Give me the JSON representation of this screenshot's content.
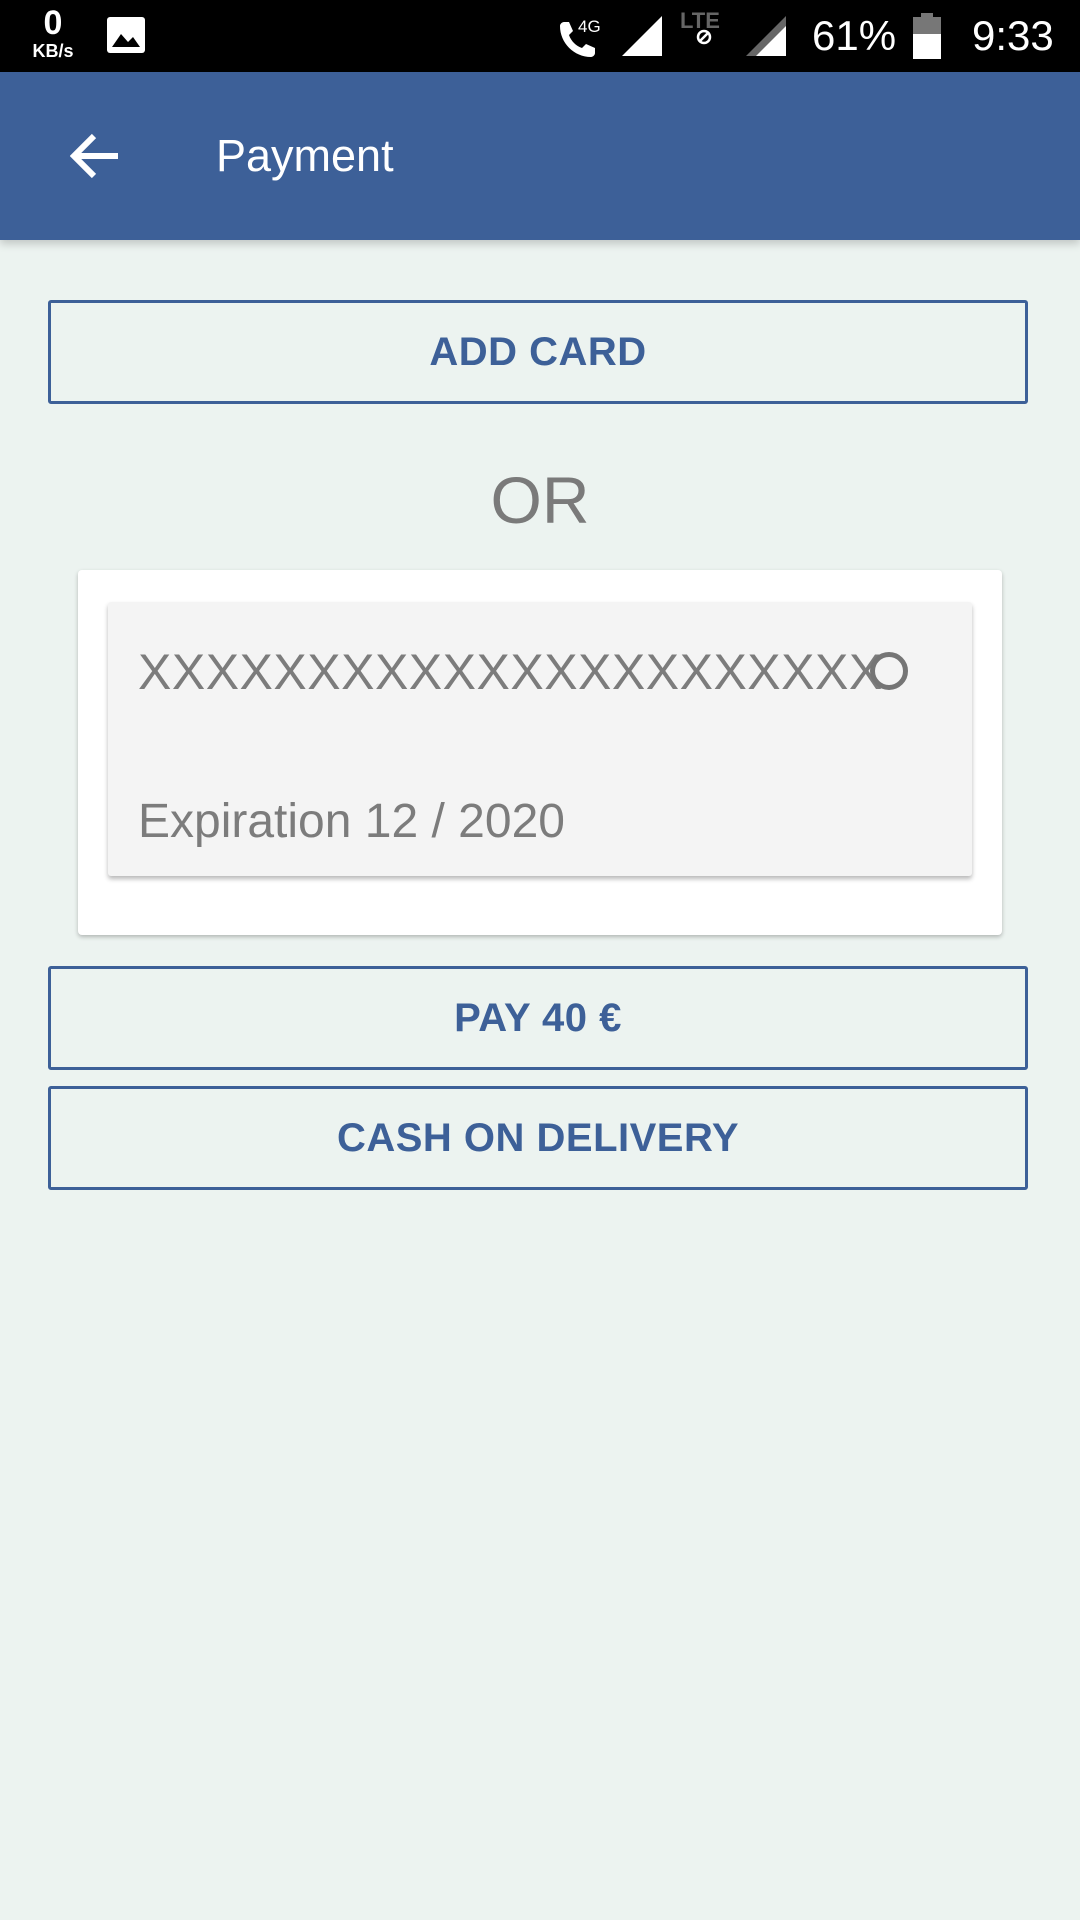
{
  "status_bar": {
    "net_speed_value": "0",
    "net_speed_unit": "KB/s",
    "call_network_label": "4G",
    "lte_label": "LTE",
    "battery_percent": "61%",
    "time": "9:33"
  },
  "app_bar": {
    "title": "Payment"
  },
  "actions": {
    "add_card_label": "ADD CARD",
    "or_label": "OR",
    "pay_label": "PAY 40 €",
    "cash_label": "CASH ON DELIVERY"
  },
  "saved_cards": [
    {
      "number": "XXXXXXXXXXXXXXXXXXXXXX",
      "expiration": "Expiration 12 / 2020",
      "selected": false
    }
  ],
  "colors": {
    "primary": "#3D6098",
    "background": "#ECF3F0",
    "text_muted": "#7C7C7C"
  }
}
